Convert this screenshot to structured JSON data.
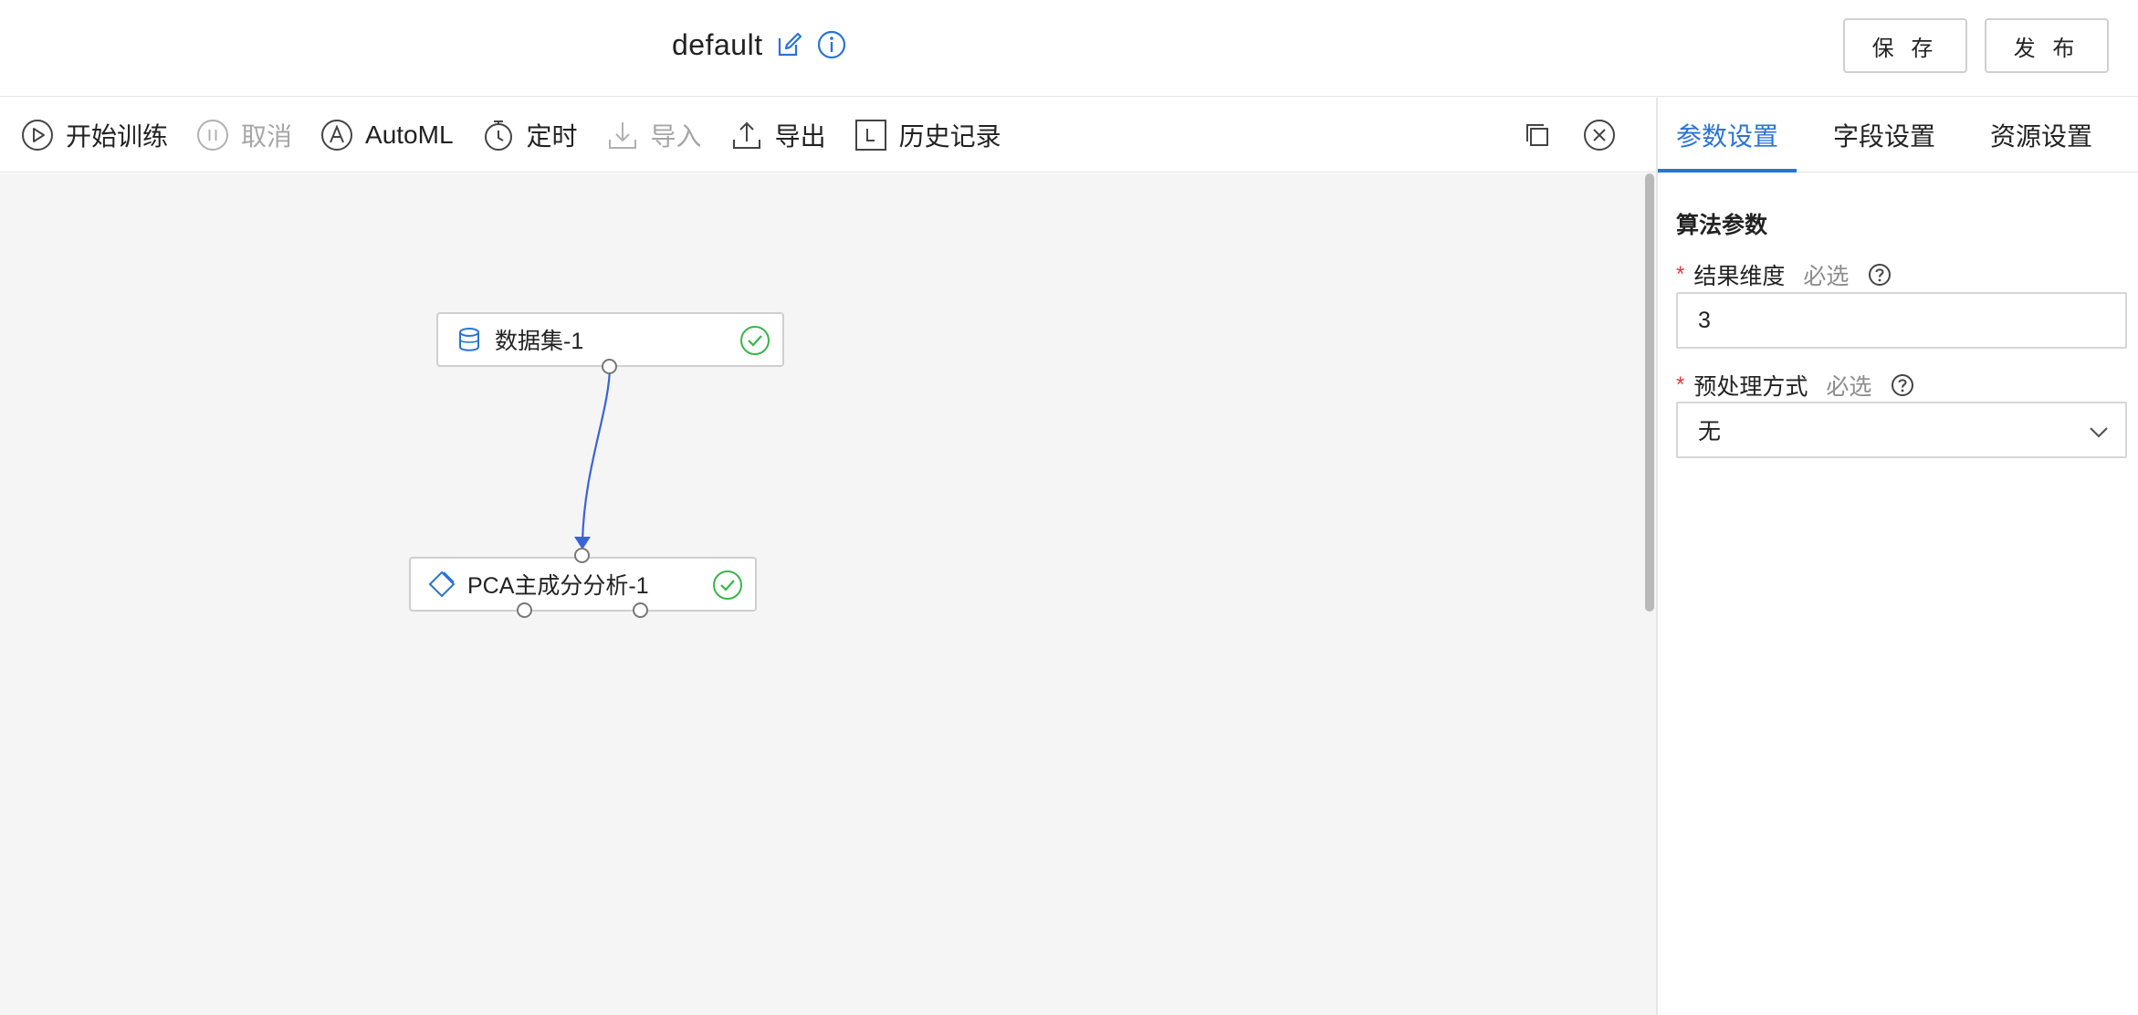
{
  "header": {
    "title": "default",
    "save_label": "保 存",
    "publish_label": "发 布"
  },
  "toolbar": {
    "start_training": "开始训练",
    "cancel": "取消",
    "automl": "AutoML",
    "schedule": "定时",
    "import": "导入",
    "export": "导出",
    "history": "历史记录"
  },
  "canvas": {
    "nodes": [
      {
        "label": "数据集-1",
        "status": "success"
      },
      {
        "label": "PCA主成分分析-1",
        "status": "success"
      }
    ]
  },
  "panel": {
    "tabs": [
      "参数设置",
      "字段设置",
      "资源设置"
    ],
    "active_tab": "参数设置",
    "section_title": "算法参数",
    "fields": [
      {
        "label": "结果维度",
        "required_mark": "*",
        "hint": "必选",
        "value": "3"
      },
      {
        "label": "预处理方式",
        "required_mark": "*",
        "hint": "必选",
        "value": "无"
      }
    ]
  },
  "colors": {
    "accent": "#2a73d6",
    "success": "#39b54a",
    "required": "#e03b3b",
    "canvas_bg": "#f5f5f5"
  }
}
